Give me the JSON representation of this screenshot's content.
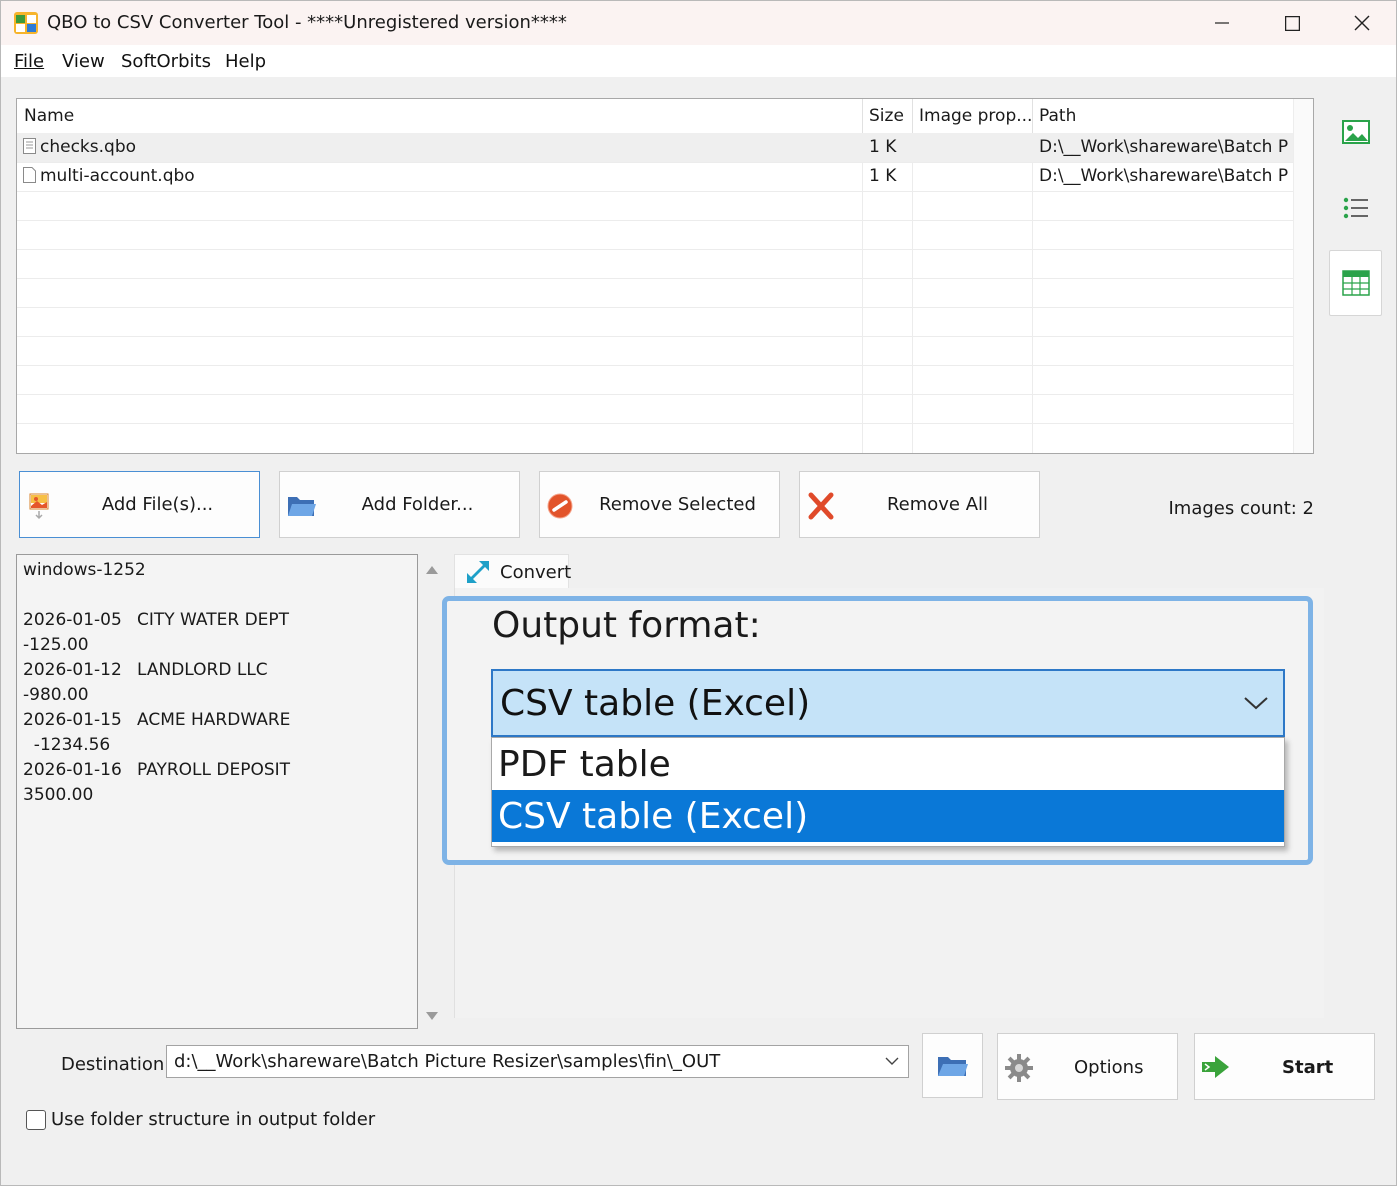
{
  "window": {
    "title": "QBO to CSV Converter Tool - ****Unregistered version****",
    "minimize_glyph": "—",
    "maximize_glyph": "☐",
    "close_glyph": "✕"
  },
  "menu": {
    "items": [
      "File",
      "View",
      "SoftOrbits",
      "Help"
    ]
  },
  "file_list": {
    "columns": [
      "Name",
      "Size",
      "Image prop...",
      "Path"
    ],
    "rows": [
      {
        "name": "checks.qbo",
        "size": "1 K",
        "props": "",
        "path": "D:\\__Work\\shareware\\Batch Pi..."
      },
      {
        "name": "multi-account.qbo",
        "size": "1 K",
        "props": "",
        "path": "D:\\__Work\\shareware\\Batch Pi..."
      }
    ]
  },
  "side_toolbar": {
    "icons": [
      "thumbnail-view-icon",
      "list-view-icon",
      "table-view-icon"
    ],
    "active": "table-view-icon"
  },
  "actions": {
    "add_files": "Add File(s)...",
    "add_folder": "Add Folder...",
    "remove_selected": "Remove Selected",
    "remove_all": "Remove All",
    "images_count": "Images count: 2"
  },
  "preview": {
    "lines": [
      {
        "a": "windows-1252",
        "b": ""
      },
      {
        "a": "",
        "b": ""
      },
      {
        "a": "2026-01-05",
        "b": "CITY WATER DEPT"
      },
      {
        "a": "-125.00",
        "b": ""
      },
      {
        "a": "2026-01-12",
        "b": "LANDLORD LLC"
      },
      {
        "a": "-980.00",
        "b": ""
      },
      {
        "a": "2026-01-15",
        "b": "ACME HARDWARE"
      },
      {
        "a": "  -1234.56",
        "b": ""
      },
      {
        "a": "2026-01-16",
        "b": "PAYROLL DEPOSIT"
      },
      {
        "a": "3500.00",
        "b": ""
      }
    ]
  },
  "convert_tab": {
    "label": "Convert",
    "output_format_label": "Output format:",
    "selected_format": "CSV table (Excel)",
    "options": [
      "PDF table",
      "CSV table (Excel)"
    ],
    "highlighted_option": "CSV table (Excel)"
  },
  "bottom": {
    "destination_label": "Destination",
    "destination_value": "d:\\__Work\\shareware\\Batch Picture Resizer\\samples\\fin\\_OUT",
    "options_label": "Options",
    "start_label": "Start",
    "folder_structure_label": "Use folder structure in output folder",
    "folder_structure_checked": false
  },
  "colors": {
    "accent": "#0a78d7",
    "combo_bg": "#c5e3f8",
    "callout_border": "#7eb3e6"
  }
}
